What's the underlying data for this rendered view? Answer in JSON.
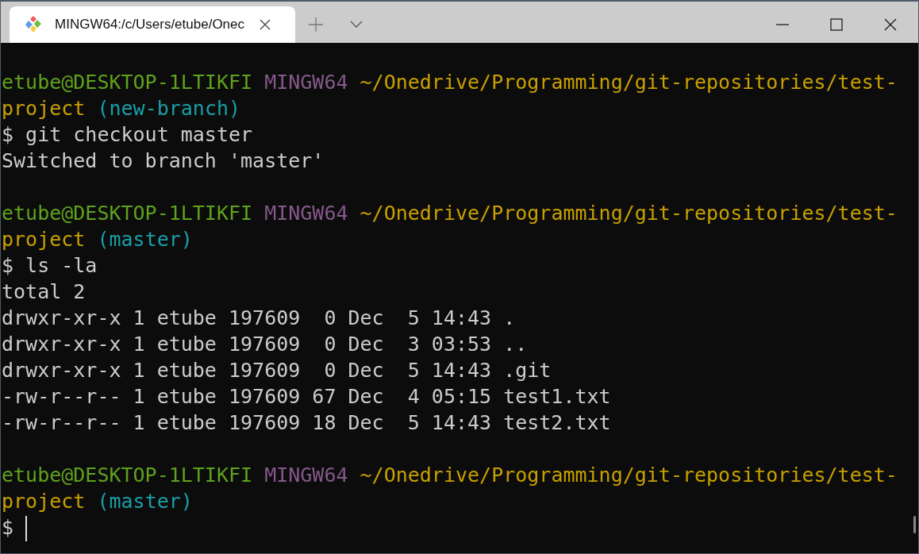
{
  "window": {
    "tab_title": "MINGW64:/c/Users/etube/Onec"
  },
  "terminal": {
    "blocks": [
      {
        "cursor": false,
        "lines": [
          [
            {
              "kind": "user",
              "text": "etube@DESKTOP-1LTIKFI"
            },
            {
              "kind": "system",
              "text": "MINGW64"
            },
            {
              "kind": "path",
              "text": "~/Onedrive/Programming/git-repositories/test-"
            }
          ],
          [
            {
              "kind": "path",
              "text": "project"
            },
            {
              "kind": "branch",
              "text": "(new-branch)"
            }
          ],
          [
            {
              "kind": "plain",
              "text": "$ git checkout master"
            }
          ],
          [
            {
              "kind": "plain",
              "text": "Switched to branch 'master'"
            }
          ]
        ]
      },
      {
        "cursor": false,
        "lines": [
          [
            {
              "kind": "user",
              "text": "etube@DESKTOP-1LTIKFI"
            },
            {
              "kind": "system",
              "text": "MINGW64"
            },
            {
              "kind": "path",
              "text": "~/Onedrive/Programming/git-repositories/test-"
            }
          ],
          [
            {
              "kind": "path",
              "text": "project"
            },
            {
              "kind": "branch",
              "text": "(master)"
            }
          ],
          [
            {
              "kind": "plain",
              "text": "$ ls -la"
            }
          ],
          [
            {
              "kind": "plain",
              "text": "total 2"
            }
          ],
          [
            {
              "kind": "plain",
              "text": "drwxr-xr-x 1 etube 197609  0 Dec  5 14:43 ."
            }
          ],
          [
            {
              "kind": "plain",
              "text": "drwxr-xr-x 1 etube 197609  0 Dec  3 03:53 .."
            }
          ],
          [
            {
              "kind": "plain",
              "text": "drwxr-xr-x 1 etube 197609  0 Dec  5 14:43 .git"
            }
          ],
          [
            {
              "kind": "plain",
              "text": "-rw-r--r-- 1 etube 197609 67 Dec  4 05:15 test1.txt"
            }
          ],
          [
            {
              "kind": "plain",
              "text": "-rw-r--r-- 1 etube 197609 18 Dec  5 14:43 test2.txt"
            }
          ]
        ]
      },
      {
        "cursor": true,
        "lines": [
          [
            {
              "kind": "user",
              "text": "etube@DESKTOP-1LTIKFI"
            },
            {
              "kind": "system",
              "text": "MINGW64"
            },
            {
              "kind": "path",
              "text": "~/Onedrive/Programming/git-repositories/test-"
            }
          ],
          [
            {
              "kind": "path",
              "text": "project"
            },
            {
              "kind": "branch",
              "text": "(master)"
            }
          ],
          [
            {
              "kind": "plain",
              "text": "$"
            }
          ]
        ]
      }
    ]
  }
}
